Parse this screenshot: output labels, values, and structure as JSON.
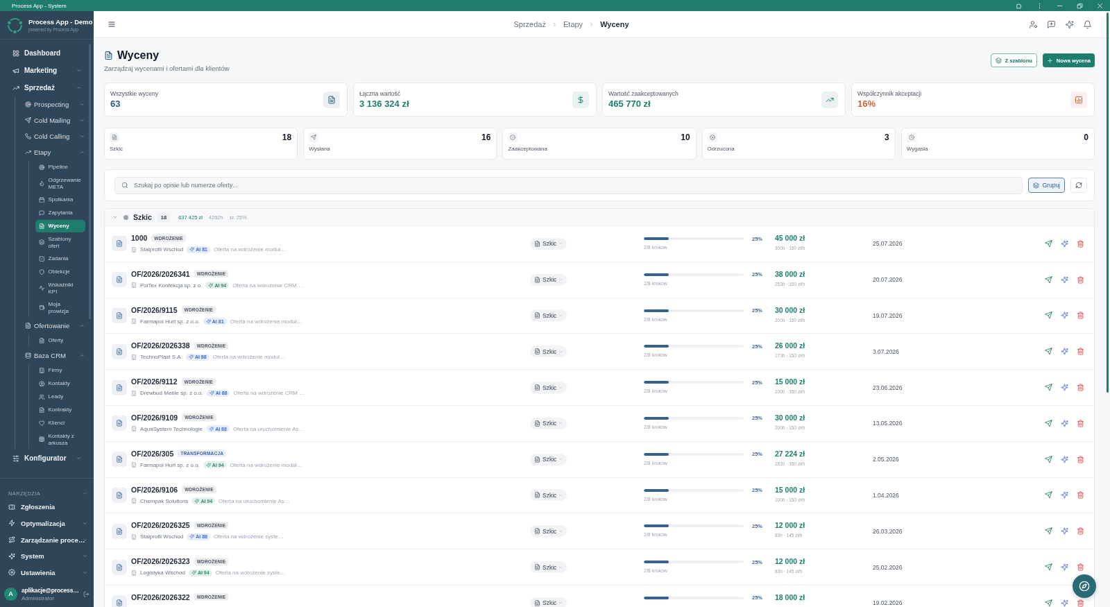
{
  "titlebar": {
    "title": "Process App - System"
  },
  "sidebar": {
    "app_name": "Process App - Demo",
    "tagline": "powered by Process App",
    "nav": [
      {
        "label": "Dashboard",
        "selected": false
      },
      {
        "label": "Marketing",
        "selected": false,
        "expanded": false
      },
      {
        "label": "Sprzedaż",
        "selected": false,
        "expanded": true,
        "children": [
          {
            "label": "Prospecting",
            "selected": false,
            "expanded": false
          },
          {
            "label": "Cold Mailing",
            "selected": false,
            "expanded": false
          },
          {
            "label": "Cold Calling",
            "selected": false,
            "expanded": false
          },
          {
            "label": "Etapy",
            "selected": false,
            "expanded": true,
            "children": [
              {
                "label": "Pipeline",
                "selected": false
              },
              {
                "label": "Odgrzewanie META",
                "selected": false
              },
              {
                "label": "Spotkania",
                "selected": false
              },
              {
                "label": "Zapytania",
                "selected": false
              },
              {
                "label": "Wyceny",
                "selected": true
              },
              {
                "label": "Szablony ofert",
                "selected": false
              },
              {
                "label": "Zadania",
                "selected": false
              },
              {
                "label": "Obiekcje",
                "selected": false
              },
              {
                "label": "Wskaźniki KPI",
                "selected": false
              },
              {
                "label": "Moja prowizja",
                "selected": false
              }
            ]
          },
          {
            "label": "Ofertowanie",
            "selected": false,
            "expanded": true,
            "children": [
              {
                "label": "Oferty",
                "selected": false
              }
            ]
          },
          {
            "label": "Baza CRM",
            "selected": false,
            "expanded": true,
            "children": [
              {
                "label": "Firmy",
                "selected": false
              },
              {
                "label": "Kontakty",
                "selected": false
              },
              {
                "label": "Leady",
                "selected": false
              },
              {
                "label": "Kontrakty",
                "selected": false
              },
              {
                "label": "Klienci",
                "selected": false
              },
              {
                "label": "Kontakty z arkusza",
                "selected": false
              }
            ]
          }
        ]
      },
      {
        "label": "Konfigurator",
        "selected": false,
        "expanded": false
      }
    ],
    "tools": {
      "heading": "NARZĘDZIA",
      "items": [
        {
          "label": "Zgłoszenia",
          "selected": false
        },
        {
          "label": "Optymalizacja",
          "selected": false,
          "expanded": false
        },
        {
          "label": "Zarządzanie proce…",
          "selected": false,
          "expanded": false
        },
        {
          "label": "System",
          "selected": false,
          "expanded": false
        },
        {
          "label": "Ustawienia",
          "selected": false,
          "expanded": false
        }
      ]
    },
    "user": {
      "initial": "A",
      "email": "aplikacje@process…",
      "role": "Administrator"
    }
  },
  "header": {
    "breadcrumb": [
      {
        "label": "Sprzedaż",
        "current": false
      },
      {
        "label": "Etapy",
        "current": false
      },
      {
        "label": "Wyceny",
        "current": true
      }
    ]
  },
  "page": {
    "title": "Wyceny",
    "subtitle": "Zarządzaj wycenami i ofertami dla klientów",
    "actions": [
      {
        "label": "Z szablonu",
        "kind": "outline"
      },
      {
        "label": "Nowa wycena",
        "kind": "primary"
      }
    ]
  },
  "stats": [
    {
      "label": "Wszystkie wyceny",
      "value": "63",
      "color": "#2e5b8a"
    },
    {
      "label": "Łączna wartość",
      "value": "3 136 324 zł",
      "color": "#1e7d6e"
    },
    {
      "label": "Wartość zaakceptowanych",
      "value": "465 770 zł",
      "color": "#1e7d6e"
    },
    {
      "label": "Współczynnik akceptacji",
      "value": "16%",
      "color": "#d0623d"
    }
  ],
  "statuses": [
    {
      "label": "Szkic",
      "count": "18"
    },
    {
      "label": "Wysłana",
      "count": "16"
    },
    {
      "label": "Zaakceptowana",
      "count": "10"
    },
    {
      "label": "Odrzucona",
      "count": "3"
    },
    {
      "label": "Wygasła",
      "count": "0"
    }
  ],
  "search": {
    "placeholder": "Szukaj po opisie lub numerze oferty...",
    "group_button": "Grupuj"
  },
  "groups": [
    {
      "label": "Szkic",
      "color": "#9ca3af",
      "count": "18",
      "total": "637 425 zł",
      "hours": "4262h",
      "average": "śr. 25%",
      "expanded": true,
      "rows": [
        {
          "number": "1000",
          "type": {
            "label": "WDROŻENIE",
            "color": "#4b5563"
          },
          "company": "Stalprofil Wschod",
          "ai": {
            "label": "AI 81",
            "color": "#3b6fd0"
          },
          "description": "Oferta na wdrożenie moduł…",
          "status": "Szkic",
          "level": 0.25,
          "percent": "25%",
          "steps": "2/8 kroków",
          "amount": "45 000 zł",
          "rate": "300h · 150 zł/h",
          "date": "25.07.2026"
        },
        {
          "number": "OF/2026/2026341",
          "type": {
            "label": "WDROŻENIE",
            "color": "#4b5563"
          },
          "company": "PolTex Konfekcja sp. z o.",
          "ai": {
            "label": "AI 94",
            "color": "#2e8b62"
          },
          "description": "Oferta na wdrożenie CRM …",
          "status": "Szkic",
          "level": 0.25,
          "percent": "25%",
          "steps": "2/8 kroków",
          "amount": "38 000 zł",
          "rate": "253h · 150 zł/h",
          "date": "20.07.2026"
        },
        {
          "number": "OF/2026/9115",
          "type": {
            "label": "WDROŻENIE",
            "color": "#4b5563"
          },
          "company": "Farmapol Hurt sp. z o.o.",
          "ai": {
            "label": "AI 81",
            "color": "#3b6fd0"
          },
          "description": "Oferta na wdrożenie moduł…",
          "status": "Szkic",
          "level": 0.25,
          "percent": "25%",
          "steps": "2/8 kroków",
          "amount": "30 000 zł",
          "rate": "200h · 150 zł/h",
          "date": "19.07.2026"
        },
        {
          "number": "OF/2026/2026338",
          "type": {
            "label": "WDROŻENIE",
            "color": "#4b5563"
          },
          "company": "TechnoPlast S.A.",
          "ai": {
            "label": "AI 88",
            "color": "#3b6fd0"
          },
          "description": "Oferta na wdrożenie moduł…",
          "status": "Szkic",
          "level": 0.25,
          "percent": "25%",
          "steps": "2/8 kroków",
          "amount": "26 000 zł",
          "rate": "173h · 150 zł/h",
          "date": "3.07.2026"
        },
        {
          "number": "OF/2026/9112",
          "type": {
            "label": "WDROŻENIE",
            "color": "#4b5563"
          },
          "company": "Drewbud Meble sp. z o.o.",
          "ai": {
            "label": "AI 88",
            "color": "#3b6fd0"
          },
          "description": "Oferta na wdrożenie CRM …",
          "status": "Szkic",
          "level": 0.25,
          "percent": "25%",
          "steps": "2/8 kroków",
          "amount": "15 000 zł",
          "rate": "100h · 150 zł/h",
          "date": "23.06.2026"
        },
        {
          "number": "OF/2026/9109",
          "type": {
            "label": "WDROŻENIE",
            "color": "#4b5563"
          },
          "company": "AquaSystem Technologie",
          "ai": {
            "label": "AI 88",
            "color": "#3b6fd0"
          },
          "description": "Oferta na uruchomienie As…",
          "status": "Szkic",
          "level": 0.25,
          "percent": "25%",
          "steps": "2/8 kroków",
          "amount": "30 000 zł",
          "rate": "200h · 150 zł/h",
          "date": "13.05.2026"
        },
        {
          "number": "OF/2026/305",
          "type": {
            "label": "TRANSFORMACJA",
            "color": "#3d6aa3"
          },
          "company": "Farmapol Hurt sp. z o.o.",
          "ai": {
            "label": "AI 94",
            "color": "#2e8b62"
          },
          "description": "Oferta na wdrożenie moduł…",
          "status": "Szkic",
          "level": 0.25,
          "percent": "25%",
          "steps": "2/8 kroków",
          "amount": "27 224 zł",
          "rate": "181h · 150 zł/h",
          "date": "2.05.2026"
        },
        {
          "number": "OF/2026/9106",
          "type": {
            "label": "WDROŻENIE",
            "color": "#4b5563"
          },
          "company": "Chempak Solutions",
          "ai": {
            "label": "AI 94",
            "color": "#2e8b62"
          },
          "description": "Oferta na uruchomienie As…",
          "status": "Szkic",
          "level": 0.25,
          "percent": "25%",
          "steps": "2/8 kroków",
          "amount": "15 000 zł",
          "rate": "100h · 150 zł/h",
          "date": "1.04.2026"
        },
        {
          "number": "OF/2026/2026325",
          "type": {
            "label": "WDROŻENIE",
            "color": "#4b5563"
          },
          "company": "Stalprofil Wschod",
          "ai": {
            "label": "AI 88",
            "color": "#3b6fd0"
          },
          "description": "Oferta na wdrożenie syste…",
          "status": "Szkic",
          "level": 0.25,
          "percent": "25%",
          "steps": "2/8 kroków",
          "amount": "12 000 zł",
          "rate": "83h · 145 zł/h",
          "date": "26.03.2026"
        },
        {
          "number": "OF/2026/2026323",
          "type": {
            "label": "WDROŻENIE",
            "color": "#4b5563"
          },
          "company": "Logistyka Wschod",
          "ai": {
            "label": "AI 94",
            "color": "#2e8b62"
          },
          "description": "Oferta na wdrożenie syste…",
          "status": "Szkic",
          "level": 0.25,
          "percent": "25%",
          "steps": "2/8 kroków",
          "amount": "12 000 zł",
          "rate": "83h · 145 zł/h",
          "date": "25.02.2026"
        },
        {
          "number": "OF/2026/2026322",
          "type": {
            "label": "WDROŻENIE",
            "color": "#4b5563"
          },
          "status": "Szkic",
          "level": 0.25,
          "percent": "25%",
          "amount": "18 000 zł",
          "date": "19.02.2026"
        }
      ]
    }
  ]
}
